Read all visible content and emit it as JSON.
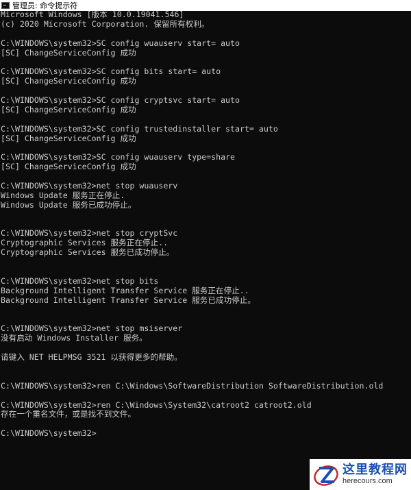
{
  "window": {
    "title": "管理员: 命令提示符"
  },
  "console": {
    "lines": [
      "Microsoft Windows [版本 10.0.19041.546]",
      "(c) 2020 Microsoft Corporation. 保留所有权利。",
      "",
      "C:\\WINDOWS\\system32>SC config wuauserv start= auto",
      "[SC] ChangeServiceConfig 成功",
      "",
      "C:\\WINDOWS\\system32>SC config bits start= auto",
      "[SC] ChangeServiceConfig 成功",
      "",
      "C:\\WINDOWS\\system32>SC config cryptsvc start= auto",
      "[SC] ChangeServiceConfig 成功",
      "",
      "C:\\WINDOWS\\system32>SC config trustedinstaller start= auto",
      "[SC] ChangeServiceConfig 成功",
      "",
      "C:\\WINDOWS\\system32>SC config wuauserv type=share",
      "[SC] ChangeServiceConfig 成功",
      "",
      "C:\\WINDOWS\\system32>net stop wuauserv",
      "Windows Update 服务正在停止.",
      "Windows Update 服务已成功停止。",
      "",
      "",
      "C:\\WINDOWS\\system32>net stop cryptSvc",
      "Cryptographic Services 服务正在停止..",
      "Cryptographic Services 服务已成功停止。",
      "",
      "",
      "C:\\WINDOWS\\system32>net stop bits",
      "Background Intelligent Transfer Service 服务正在停止..",
      "Background Intelligent Transfer Service 服务已成功停止。",
      "",
      "",
      "C:\\WINDOWS\\system32>net stop msiserver",
      "没有启动 Windows Installer 服务。",
      "",
      "请键入 NET HELPMSG 3521 以获得更多的帮助。",
      "",
      "",
      "C:\\WINDOWS\\system32>ren C:\\Windows\\SoftwareDistribution SoftwareDistribution.old",
      "",
      "C:\\WINDOWS\\system32>ren C:\\Windows\\System32\\catroot2 catroot2.old",
      "存在一个重名文件，或是找不到文件。",
      "",
      "C:\\WINDOWS\\system32>"
    ]
  },
  "watermark": {
    "name_cn": "这里教程网",
    "domain": "herecours.com"
  },
  "colors": {
    "console_bg": "#0c0c0c",
    "console_text": "#cccccc",
    "watermark_accent": "#1a4fb5"
  }
}
